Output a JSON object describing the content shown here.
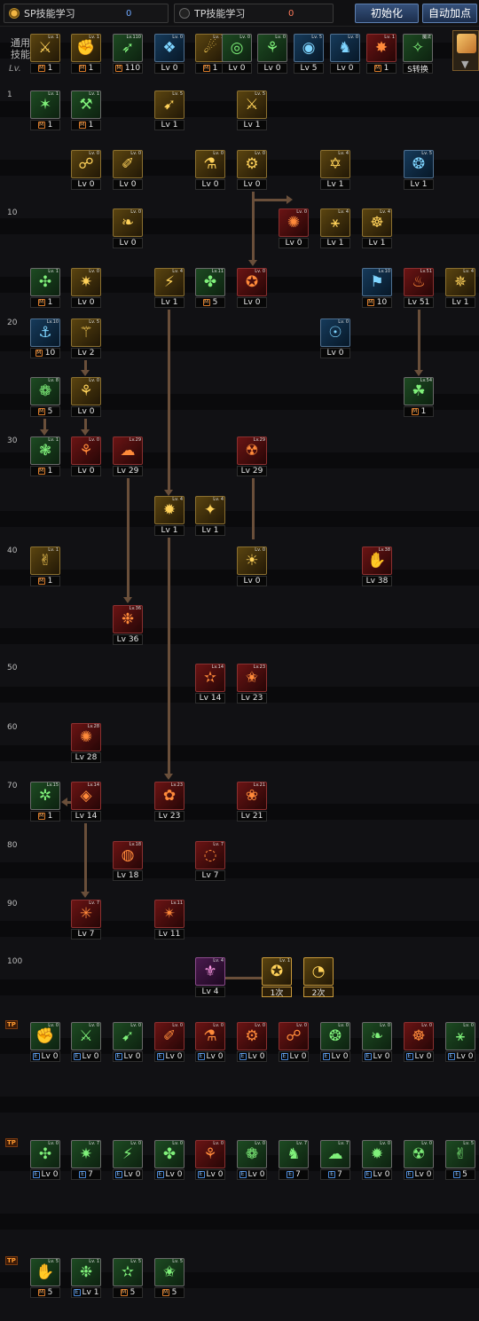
{
  "header": {
    "sp_tab_label": "SP技能学习",
    "sp_value": "0",
    "tp_tab_label": "TP技能学习",
    "tp_value": "0",
    "reset_button": "初始化",
    "auto_button": "自动加点"
  },
  "common": {
    "label": "通用技能",
    "lv_header": "Lv."
  },
  "levels": [
    "1",
    "10",
    "20",
    "30",
    "40",
    "50",
    "60",
    "70",
    "80",
    "90",
    "100"
  ],
  "colors": {
    "accent": "#c99a3a",
    "connector": "#6a4f3a",
    "sp_value": "#6fa8ff",
    "tp_badge": "#ff9a30"
  },
  "tp_mark": "TP",
  "skills": [
    {
      "name": "common-skill-1",
      "label": "1",
      "m": true,
      "color": "y",
      "glyph": "⚔",
      "lvtag": "Lv. 1"
    },
    {
      "name": "common-skill-2",
      "label": "1",
      "m": true,
      "color": "y",
      "glyph": "✊",
      "lvtag": "Lv. 1"
    },
    {
      "name": "common-skill-3",
      "label": "110",
      "m": true,
      "color": "g",
      "glyph": "➶",
      "lvtag": "Lv.110"
    },
    {
      "name": "common-skill-4",
      "label": "Lv 0",
      "m": false,
      "color": "b",
      "glyph": "❖",
      "lvtag": "Lv. 0"
    },
    {
      "name": "common-skill-5",
      "label": "1",
      "m": true,
      "color": "y",
      "glyph": "☄",
      "lvtag": "Lv. 1"
    },
    {
      "name": "common-skill-6",
      "label": "Lv 0",
      "m": false,
      "color": "g",
      "glyph": "◎",
      "lvtag": "Lv. 0"
    },
    {
      "name": "common-skill-7",
      "label": "Lv 0",
      "m": false,
      "color": "g",
      "glyph": "⚘",
      "lvtag": "Lv. 0"
    },
    {
      "name": "common-skill-8",
      "label": "Lv 5",
      "m": false,
      "color": "b",
      "glyph": "◉",
      "lvtag": "Lv. 5"
    },
    {
      "name": "common-skill-9",
      "label": "Lv 0",
      "m": false,
      "color": "b",
      "glyph": "♞",
      "lvtag": "Lv. 0"
    },
    {
      "name": "common-skill-10",
      "label": "1",
      "m": true,
      "color": "r",
      "glyph": "✸",
      "lvtag": "Lv. 1"
    },
    {
      "name": "common-skill-11",
      "label": "S转换",
      "m": false,
      "color": "g",
      "glyph": "✧",
      "lvtag": "魔法"
    },
    {
      "name": "skill-r1-a",
      "label": "1",
      "m": true,
      "color": "g",
      "glyph": "✶",
      "lvtag": "Lv. 1"
    },
    {
      "name": "skill-r1-b",
      "label": "1",
      "m": true,
      "color": "g",
      "glyph": "⚒",
      "lvtag": "Lv. 1"
    },
    {
      "name": "skill-r1-c",
      "label": "Lv 1",
      "m": false,
      "color": "y",
      "glyph": "➹",
      "lvtag": "Lv. 5"
    },
    {
      "name": "skill-r1-d",
      "label": "Lv 1",
      "m": false,
      "color": "y",
      "glyph": "⚔",
      "lvtag": "Lv. 5"
    },
    {
      "name": "skill-r5-a",
      "label": "Lv 0",
      "m": false,
      "color": "y",
      "glyph": "☍",
      "lvtag": "Lv. 0"
    },
    {
      "name": "skill-r5-b",
      "label": "Lv 0",
      "m": false,
      "color": "y",
      "glyph": "✐",
      "lvtag": "Lv. 0"
    },
    {
      "name": "skill-r5-c",
      "label": "Lv 0",
      "m": false,
      "color": "y",
      "glyph": "⚗",
      "lvtag": "Lv. 0"
    },
    {
      "name": "skill-r5-d",
      "label": "Lv 0",
      "m": false,
      "color": "y",
      "glyph": "⚙",
      "lvtag": "Lv. 0"
    },
    {
      "name": "skill-r5-e",
      "label": "Lv 1",
      "m": false,
      "color": "y",
      "glyph": "✡",
      "lvtag": "Lv. 4"
    },
    {
      "name": "skill-r5-f",
      "label": "Lv 1",
      "m": false,
      "color": "b",
      "glyph": "❂",
      "lvtag": "Lv. 5"
    },
    {
      "name": "skill-r10-a",
      "label": "Lv 0",
      "m": false,
      "color": "y",
      "glyph": "❧",
      "lvtag": "Lv. 0"
    },
    {
      "name": "skill-r10-b",
      "label": "Lv 0",
      "m": false,
      "color": "r",
      "glyph": "✺",
      "lvtag": "Lv. 0"
    },
    {
      "name": "skill-r10-c",
      "label": "Lv 1",
      "m": false,
      "color": "y",
      "glyph": "⚹",
      "lvtag": "Lv. 4"
    },
    {
      "name": "skill-r10-d",
      "label": "Lv 1",
      "m": false,
      "color": "y",
      "glyph": "☸",
      "lvtag": "Lv. 4"
    },
    {
      "name": "skill-r15-a",
      "label": "1",
      "m": true,
      "color": "g",
      "glyph": "✣",
      "lvtag": "Lv. 1"
    },
    {
      "name": "skill-r15-b",
      "label": "Lv 0",
      "m": false,
      "color": "y",
      "glyph": "✷",
      "lvtag": "Lv. 0"
    },
    {
      "name": "skill-r15-c",
      "label": "Lv 1",
      "m": false,
      "color": "y",
      "glyph": "⚡",
      "lvtag": "Lv. 4"
    },
    {
      "name": "skill-r15-d",
      "label": "5",
      "m": true,
      "color": "g",
      "glyph": "✤",
      "lvtag": "Lv.11"
    },
    {
      "name": "skill-r15-e",
      "label": "Lv 0",
      "m": false,
      "color": "r",
      "glyph": "✪",
      "lvtag": "Lv. 0"
    },
    {
      "name": "skill-r15-f",
      "label": "10",
      "m": true,
      "color": "b",
      "glyph": "⚑",
      "lvtag": "Lv.10"
    },
    {
      "name": "skill-r15-g",
      "label": "Lv 51",
      "m": false,
      "color": "r",
      "glyph": "♨",
      "lvtag": "Lv.51"
    },
    {
      "name": "skill-r15-h",
      "label": "Lv 1",
      "m": false,
      "color": "y",
      "glyph": "✵",
      "lvtag": "Lv. 4"
    },
    {
      "name": "skill-r20-a",
      "label": "10",
      "m": true,
      "color": "b",
      "glyph": "⚓",
      "lvtag": "Lv.10"
    },
    {
      "name": "skill-r20-b",
      "label": "Lv 2",
      "m": false,
      "color": "y",
      "glyph": "⚚",
      "lvtag": "Lv. 5"
    },
    {
      "name": "skill-r20-c",
      "label": "Lv 0",
      "m": false,
      "color": "b",
      "glyph": "☉",
      "lvtag": "Lv. 0"
    },
    {
      "name": "skill-r25-a",
      "label": "5",
      "m": true,
      "color": "g",
      "glyph": "❁",
      "lvtag": "Lv. 8"
    },
    {
      "name": "skill-r25-b",
      "label": "Lv 0",
      "m": false,
      "color": "y",
      "glyph": "⚘",
      "lvtag": "Lv. 0"
    },
    {
      "name": "skill-r25-c",
      "label": "1",
      "m": true,
      "color": "g",
      "glyph": "☘",
      "lvtag": "Lv.54"
    },
    {
      "name": "skill-r30-a",
      "label": "1",
      "m": true,
      "color": "g",
      "glyph": "❃",
      "lvtag": "Lv. 1"
    },
    {
      "name": "skill-r30-b",
      "label": "Lv 0",
      "m": false,
      "color": "r",
      "glyph": "⚘",
      "lvtag": "Lv. 0"
    },
    {
      "name": "skill-r30-c",
      "label": "Lv 29",
      "m": false,
      "color": "r",
      "glyph": "☁",
      "lvtag": "Lv.29"
    },
    {
      "name": "skill-r30-d",
      "label": "Lv 29",
      "m": false,
      "color": "r",
      "glyph": "☢",
      "lvtag": "Lv.29"
    },
    {
      "name": "skill-r35-a",
      "label": "Lv 1",
      "m": false,
      "color": "y",
      "glyph": "✹",
      "lvtag": "Lv. 4"
    },
    {
      "name": "skill-r35-b",
      "label": "Lv 1",
      "m": false,
      "color": "y",
      "glyph": "✦",
      "lvtag": "Lv. 4"
    },
    {
      "name": "skill-r40-a",
      "label": "1",
      "m": true,
      "color": "y",
      "glyph": "✌",
      "lvtag": "Lv. 1"
    },
    {
      "name": "skill-r40-b",
      "label": "Lv 0",
      "m": false,
      "color": "y",
      "glyph": "☀",
      "lvtag": "Lv. 0"
    },
    {
      "name": "skill-r40-c",
      "label": "Lv 38",
      "m": false,
      "color": "r",
      "glyph": "✋",
      "lvtag": "Lv.38"
    },
    {
      "name": "skill-r45-a",
      "label": "Lv 36",
      "m": false,
      "color": "r",
      "glyph": "❉",
      "lvtag": "Lv.36"
    },
    {
      "name": "skill-r50-a",
      "label": "Lv 14",
      "m": false,
      "color": "r",
      "glyph": "✫",
      "lvtag": "Lv.14"
    },
    {
      "name": "skill-r50-b",
      "label": "Lv 23",
      "m": false,
      "color": "r",
      "glyph": "✬",
      "lvtag": "Lv.23"
    },
    {
      "name": "skill-r60-a",
      "label": "Lv 28",
      "m": false,
      "color": "r",
      "glyph": "✺",
      "lvtag": "Lv.28"
    },
    {
      "name": "skill-r70-a",
      "label": "1",
      "m": true,
      "color": "g",
      "glyph": "✲",
      "lvtag": "Lv.15"
    },
    {
      "name": "skill-r70-b",
      "label": "Lv 14",
      "m": false,
      "color": "r",
      "glyph": "◈",
      "lvtag": "Lv.14"
    },
    {
      "name": "skill-r70-c",
      "label": "Lv 23",
      "m": false,
      "color": "r",
      "glyph": "✿",
      "lvtag": "Lv.23"
    },
    {
      "name": "skill-r70-d",
      "label": "Lv 21",
      "m": false,
      "color": "r",
      "glyph": "❀",
      "lvtag": "Lv.21"
    },
    {
      "name": "skill-r80-a",
      "label": "Lv 18",
      "m": false,
      "color": "r",
      "glyph": "◍",
      "lvtag": "Lv.18"
    },
    {
      "name": "skill-r80-b",
      "label": "Lv 7",
      "m": false,
      "color": "r",
      "glyph": "◌",
      "lvtag": "Lv. 7"
    },
    {
      "name": "skill-r90-a",
      "label": "Lv 7",
      "m": false,
      "color": "r",
      "glyph": "✳",
      "lvtag": "Lv. 7"
    },
    {
      "name": "skill-r90-b",
      "label": "Lv 11",
      "m": false,
      "color": "r",
      "glyph": "✴",
      "lvtag": "Lv.11"
    },
    {
      "name": "skill-r100-a",
      "label": "Lv 4",
      "m": false,
      "color": "p",
      "glyph": "⚜",
      "lvtag": "Lv. 4"
    },
    {
      "name": "skill-r100-b",
      "label": "1次",
      "m": false,
      "color": "y",
      "glyph": "✪",
      "lvtag": "Lv. 1",
      "awk": true
    },
    {
      "name": "skill-r100-c",
      "label": "2次",
      "m": false,
      "color": "y",
      "glyph": "◔",
      "lvtag": "",
      "awk": true
    },
    {
      "name": "tp1-1",
      "label": "Lv 0",
      "m": false,
      "color": "g",
      "glyph": "✊",
      "lvtag": "Lv. 0",
      "tp": true
    },
    {
      "name": "tp1-2",
      "label": "Lv 0",
      "m": false,
      "color": "g",
      "glyph": "⚔",
      "lvtag": "Lv. 0",
      "tp": true
    },
    {
      "name": "tp1-3",
      "label": "Lv 0",
      "m": false,
      "color": "g",
      "glyph": "➹",
      "lvtag": "Lv. 0",
      "tp": true
    },
    {
      "name": "tp1-4",
      "label": "Lv 0",
      "m": false,
      "color": "r",
      "glyph": "✐",
      "lvtag": "Lv. 0",
      "tp": true
    },
    {
      "name": "tp1-5",
      "label": "Lv 0",
      "m": false,
      "color": "r",
      "glyph": "⚗",
      "lvtag": "Lv. 0",
      "tp": true
    },
    {
      "name": "tp1-6",
      "label": "Lv 0",
      "m": false,
      "color": "r",
      "glyph": "⚙",
      "lvtag": "Lv. 0",
      "tp": true
    },
    {
      "name": "tp1-7",
      "label": "Lv 0",
      "m": false,
      "color": "r",
      "glyph": "☍",
      "lvtag": "Lv. 0",
      "tp": true
    },
    {
      "name": "tp1-8",
      "label": "Lv 0",
      "m": false,
      "color": "g",
      "glyph": "❂",
      "lvtag": "Lv. 0",
      "tp": true
    },
    {
      "name": "tp1-9",
      "label": "Lv 0",
      "m": false,
      "color": "g",
      "glyph": "❧",
      "lvtag": "Lv. 0",
      "tp": true
    },
    {
      "name": "tp1-10",
      "label": "Lv 0",
      "m": false,
      "color": "r",
      "glyph": "☸",
      "lvtag": "Lv. 0",
      "tp": true
    },
    {
      "name": "tp1-11",
      "label": "Lv 0",
      "m": false,
      "color": "g",
      "glyph": "⚹",
      "lvtag": "Lv. 0",
      "tp": true
    },
    {
      "name": "tp2-1",
      "label": "Lv 0",
      "m": false,
      "color": "g",
      "glyph": "✣",
      "lvtag": "Lv. 0",
      "tp": true
    },
    {
      "name": "tp2-2",
      "label": "7",
      "m": false,
      "color": "g",
      "glyph": "✷",
      "lvtag": "Lv. 7",
      "tp": true
    },
    {
      "name": "tp2-3",
      "label": "Lv 0",
      "m": false,
      "color": "g",
      "glyph": "⚡",
      "lvtag": "Lv. 0",
      "tp": true
    },
    {
      "name": "tp2-4",
      "label": "Lv 0",
      "m": false,
      "color": "g",
      "glyph": "✤",
      "lvtag": "Lv. 0",
      "tp": true
    },
    {
      "name": "tp2-5",
      "label": "Lv 0",
      "m": false,
      "color": "r",
      "glyph": "⚘",
      "lvtag": "Lv. 0",
      "tp": true
    },
    {
      "name": "tp2-6",
      "label": "Lv 0",
      "m": false,
      "color": "g",
      "glyph": "❁",
      "lvtag": "Lv. 0",
      "tp": true
    },
    {
      "name": "tp2-7",
      "label": "7",
      "m": false,
      "color": "g",
      "glyph": "♞",
      "lvtag": "Lv. 7",
      "tp": true
    },
    {
      "name": "tp2-8",
      "label": "7",
      "m": false,
      "color": "g",
      "glyph": "☁",
      "lvtag": "Lv. 7",
      "tp": true
    },
    {
      "name": "tp2-9",
      "label": "Lv 0",
      "m": false,
      "color": "g",
      "glyph": "✹",
      "lvtag": "Lv. 0",
      "tp": true
    },
    {
      "name": "tp2-10",
      "label": "Lv 0",
      "m": false,
      "color": "g",
      "glyph": "☢",
      "lvtag": "Lv. 0",
      "tp": true
    },
    {
      "name": "tp2-11",
      "label": "5",
      "m": false,
      "color": "g",
      "glyph": "✌",
      "lvtag": "Lv. 5",
      "tp": true
    },
    {
      "name": "tp3-1",
      "label": "5",
      "m": true,
      "color": "g",
      "glyph": "✋",
      "lvtag": "Lv. 5",
      "tp": true
    },
    {
      "name": "tp3-2",
      "label": "Lv 1",
      "m": false,
      "color": "g",
      "glyph": "❉",
      "lvtag": "Lv. 1",
      "tp": true
    },
    {
      "name": "tp3-3",
      "label": "5",
      "m": true,
      "color": "g",
      "glyph": "✫",
      "lvtag": "Lv. 5",
      "tp": true
    },
    {
      "name": "tp3-4",
      "label": "5",
      "m": true,
      "color": "g",
      "glyph": "✬",
      "lvtag": "Lv. 5",
      "tp": true
    }
  ]
}
